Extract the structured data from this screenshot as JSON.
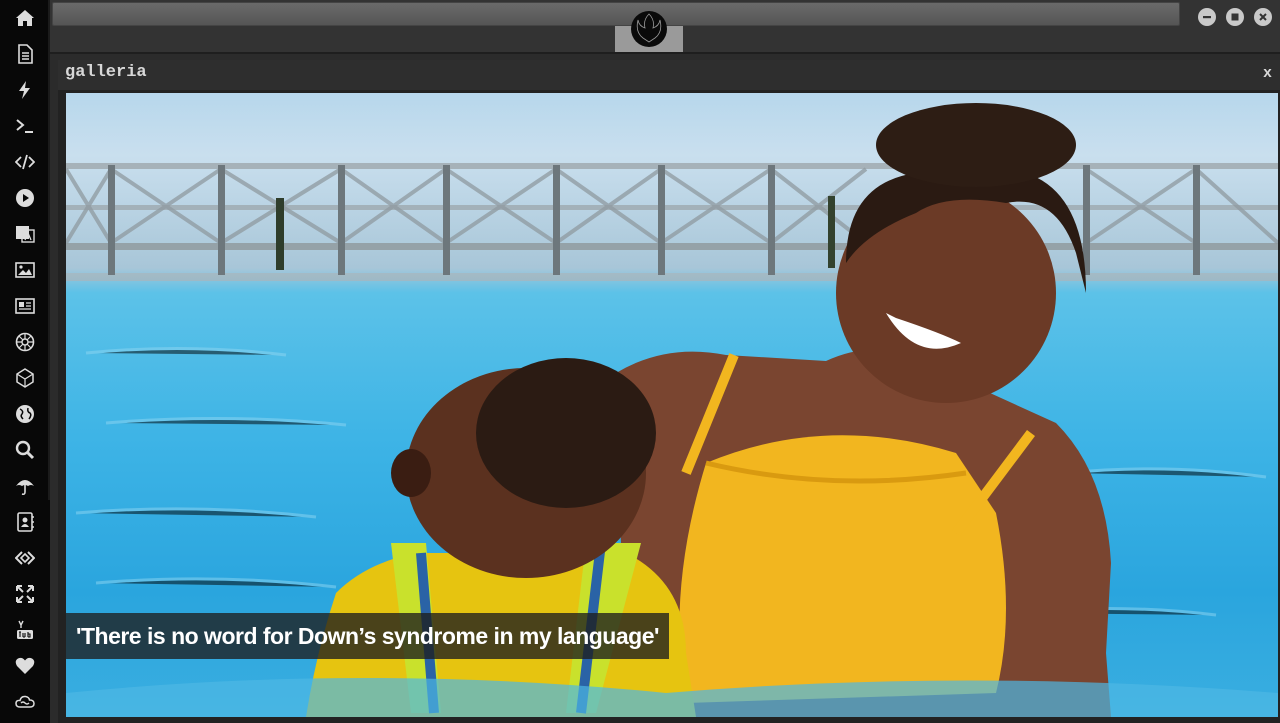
{
  "sidebar": {
    "icons": [
      "home-icon",
      "document-icon",
      "lightning-icon",
      "terminal-icon",
      "code-icon",
      "play-icon",
      "translate-icon",
      "image-icon",
      "newspaper-icon",
      "empire-icon",
      "cube-icon",
      "globe-icon",
      "search-icon",
      "umbrella-icon",
      "contact-book-icon",
      "code-diamond-icon",
      "fullscreen-icon",
      "youtube-icon",
      "heart-icon",
      "cloud-icon"
    ]
  },
  "topbar": {
    "logo": "rebel-alliance-icon",
    "window_buttons": [
      "minimize-icon",
      "maximize-icon",
      "close-icon"
    ]
  },
  "gallery": {
    "title": "galleria",
    "close_label": "x",
    "caption": "'There is no word for Down’s syndrome in my language'"
  }
}
